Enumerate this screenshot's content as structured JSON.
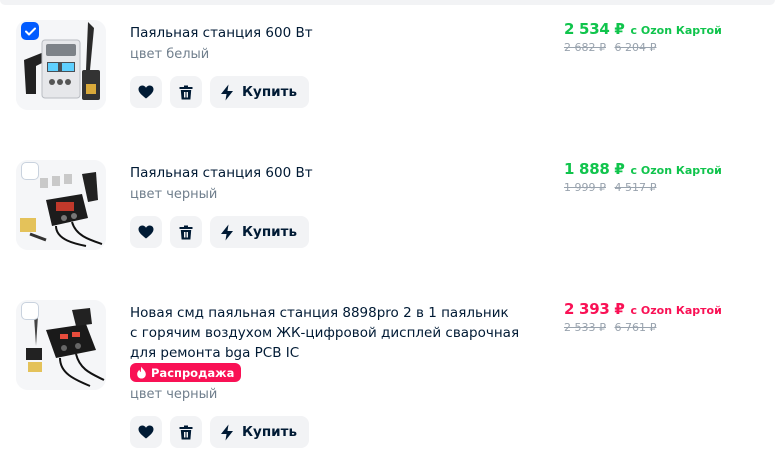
{
  "items": [
    {
      "checked": true,
      "title": "Паяльная станция 600 Вт",
      "color": "цвет белый",
      "price": "2 534 ₽",
      "card_label": "с Ozon Картой",
      "old_price_1": "2 682 ₽",
      "old_price_2": "6 204 ₽",
      "price_color": "#10c44c"
    },
    {
      "checked": false,
      "title": "Паяльная станция 600 Вт",
      "color": "цвет черный",
      "price": "1 888 ₽",
      "card_label": "с Ozon Картой",
      "old_price_1": "1 999 ₽",
      "old_price_2": "4 517 ₽",
      "price_color": "#10c44c"
    },
    {
      "checked": false,
      "title": "Новая смд паяльная станция 8898pro 2 в 1 паяльник с горячим воздухом ЖК-цифровой дисплей сварочная для ремонта bga PCB IC",
      "badge": "Распродажа",
      "color": "цвет черный",
      "price": "2 393 ₽",
      "card_label": "с Ozon Картой",
      "old_price_1": "2 533 ₽",
      "old_price_2": "6 761 ₽",
      "price_color": "#f91155"
    }
  ],
  "buttons": {
    "favorite_icon": "heart-icon",
    "delete_icon": "trash-icon",
    "buy_icon": "lightning-icon",
    "buy_label": "Купить"
  },
  "colors": {
    "accent": "#005bff",
    "discount_green": "#10c44c",
    "sale_red": "#f91155"
  }
}
